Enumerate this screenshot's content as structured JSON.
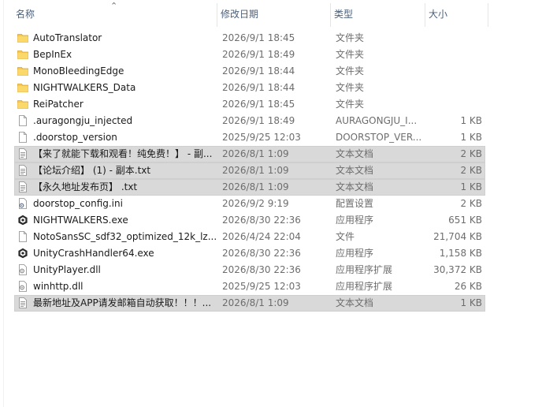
{
  "columns": {
    "name": "名称",
    "date": "修改日期",
    "type": "类型",
    "size": "大小"
  },
  "files": [
    {
      "name": "AutoTranslator",
      "date": "2026/9/1 18:45",
      "type": "文件夹",
      "size": "",
      "icon": "folder-icon",
      "selected": false
    },
    {
      "name": "BepInEx",
      "date": "2026/9/1 18:49",
      "type": "文件夹",
      "size": "",
      "icon": "folder-icon",
      "selected": false
    },
    {
      "name": "MonoBleedingEdge",
      "date": "2026/9/1 18:44",
      "type": "文件夹",
      "size": "",
      "icon": "folder-icon",
      "selected": false
    },
    {
      "name": "NIGHTWALKERS_Data",
      "date": "2026/9/1 18:44",
      "type": "文件夹",
      "size": "",
      "icon": "folder-icon",
      "selected": false
    },
    {
      "name": "ReiPatcher",
      "date": "2026/9/1 18:45",
      "type": "文件夹",
      "size": "",
      "icon": "folder-icon",
      "selected": false
    },
    {
      "name": ".auragongju_injected",
      "date": "2026/9/1 18:49",
      "type": "AURAGONGJU_I...",
      "size": "1 KB",
      "icon": "file-icon",
      "selected": false
    },
    {
      "name": ".doorstop_version",
      "date": "2025/9/25 12:03",
      "type": "DOORSTOP_VER...",
      "size": "1 KB",
      "icon": "file-icon",
      "selected": false
    },
    {
      "name": "【来了就能下载和观看！纯免费！】 - 副...",
      "date": "2026/8/1 1:09",
      "type": "文本文档",
      "size": "2 KB",
      "icon": "text-document-icon",
      "selected": true
    },
    {
      "name": "【论坛介绍】 (1) - 副本.txt",
      "date": "2026/8/1 1:09",
      "type": "文本文档",
      "size": "2 KB",
      "icon": "text-document-icon",
      "selected": true
    },
    {
      "name": "【永久地址发布页】 .txt",
      "date": "2026/8/1 1:09",
      "type": "文本文档",
      "size": "1 KB",
      "icon": "text-document-icon",
      "selected": true
    },
    {
      "name": "doorstop_config.ini",
      "date": "2026/9/2 9:19",
      "type": "配置设置",
      "size": "2 KB",
      "icon": "config-file-icon",
      "selected": false
    },
    {
      "name": "NIGHTWALKERS.exe",
      "date": "2026/8/30 22:36",
      "type": "应用程序",
      "size": "651 KB",
      "icon": "unity-app-icon",
      "selected": false
    },
    {
      "name": "NotoSansSC_sdf32_optimized_12k_lz...",
      "date": "2026/4/24 22:04",
      "type": "文件",
      "size": "21,704 KB",
      "icon": "file-icon",
      "selected": false
    },
    {
      "name": "UnityCrashHandler64.exe",
      "date": "2026/8/30 22:36",
      "type": "应用程序",
      "size": "1,158 KB",
      "icon": "unity-app-icon",
      "selected": false
    },
    {
      "name": "UnityPlayer.dll",
      "date": "2026/8/30 22:36",
      "type": "应用程序扩展",
      "size": "30,372 KB",
      "icon": "dll-file-icon",
      "selected": false
    },
    {
      "name": "winhttp.dll",
      "date": "2025/9/25 12:03",
      "type": "应用程序扩展",
      "size": "26 KB",
      "icon": "dll-file-icon",
      "selected": false
    },
    {
      "name": "最新地址及APP请发邮箱自动获取！！！...",
      "date": "2026/8/1 1:09",
      "type": "文本文档",
      "size": "1 KB",
      "icon": "text-document-icon",
      "selected": true
    }
  ]
}
